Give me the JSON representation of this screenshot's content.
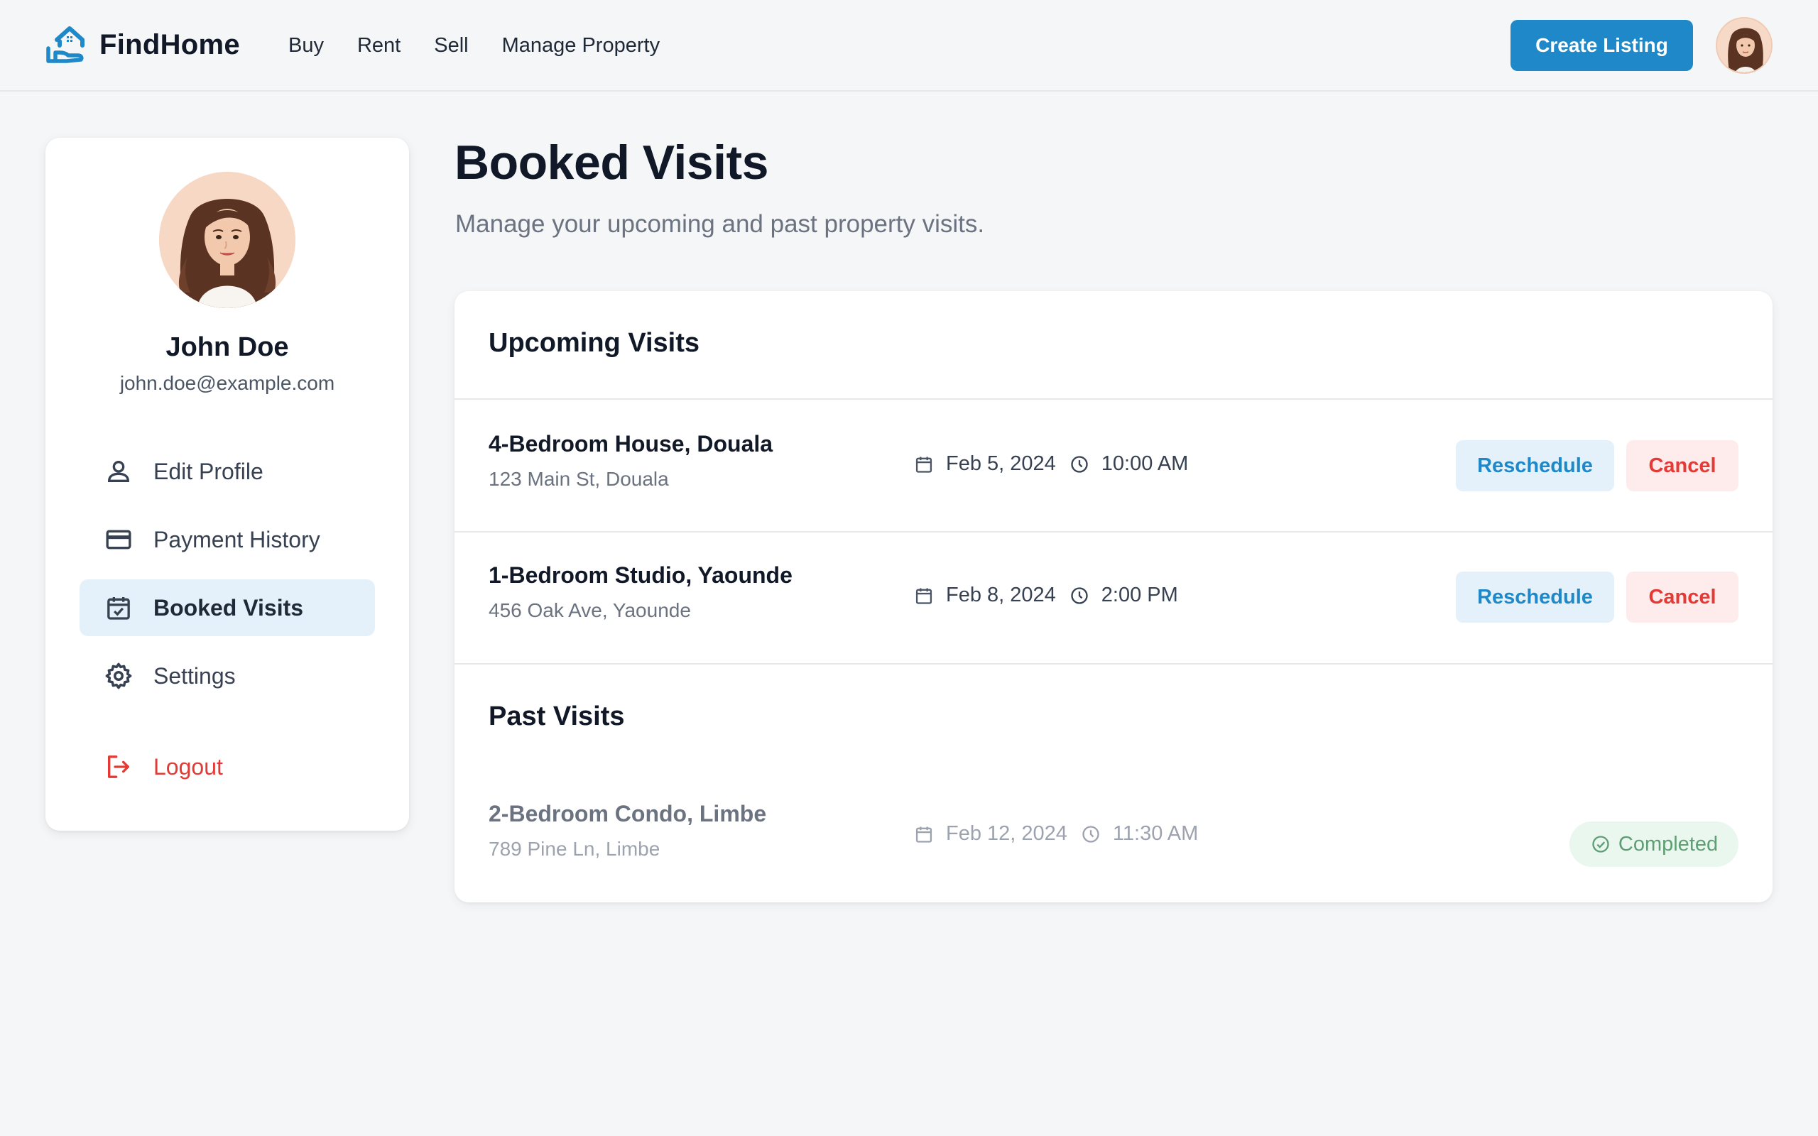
{
  "app": {
    "brand": "FindHome",
    "nav": [
      "Buy",
      "Rent",
      "Sell",
      "Manage Property"
    ],
    "create_listing": "Create Listing",
    "accent_color": "#1e88c8"
  },
  "profile": {
    "name": "John Doe",
    "email": "john.doe@example.com"
  },
  "sidebar": {
    "items": [
      {
        "label": "Edit Profile",
        "icon": "user-icon"
      },
      {
        "label": "Payment History",
        "icon": "credit-card-icon"
      },
      {
        "label": "Booked Visits",
        "icon": "calendar-check-icon",
        "active": true
      },
      {
        "label": "Settings",
        "icon": "gear-icon"
      }
    ],
    "logout": {
      "label": "Logout",
      "icon": "logout-icon"
    }
  },
  "page": {
    "title": "Booked Visits",
    "subtitle": "Manage your upcoming and past property visits."
  },
  "upcoming": {
    "title": "Upcoming Visits",
    "visits": [
      {
        "title": "4-Bedroom House, Douala",
        "address": "123 Main St, Douala",
        "date": "Feb 5, 2024",
        "time": "10:00 AM",
        "reschedule": "Reschedule",
        "cancel": "Cancel"
      },
      {
        "title": "1-Bedroom Studio, Yaounde",
        "address": "456 Oak Ave, Yaounde",
        "date": "Feb 8, 2024",
        "time": "2:00 PM",
        "reschedule": "Reschedule",
        "cancel": "Cancel"
      }
    ]
  },
  "past": {
    "title": "Past Visits",
    "visits": [
      {
        "title": "2-Bedroom Condo, Limbe",
        "address": "789 Pine Ln, Limbe",
        "date": "Feb 12, 2024",
        "time": "11:30 AM",
        "status": "Completed"
      }
    ]
  }
}
